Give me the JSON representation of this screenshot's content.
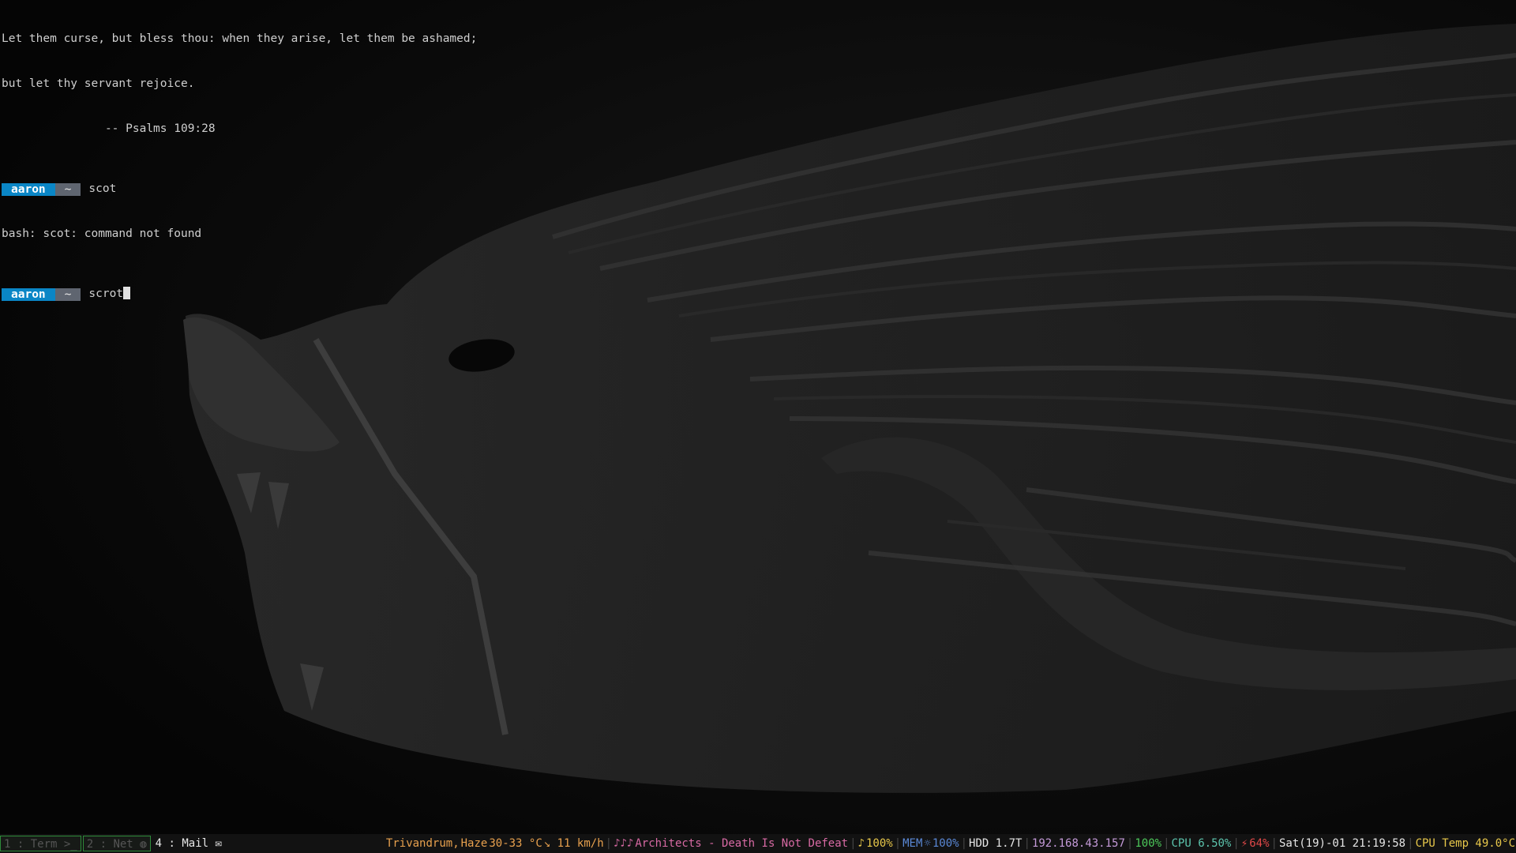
{
  "terminal": {
    "fortune": [
      "Let them curse, but bless thou: when they arise, let them be ashamed;",
      "but let thy servant rejoice.",
      "               -- Psalms 109:28"
    ],
    "prompt_user": "aaron",
    "prompt_dir": "~",
    "history": [
      {
        "command": "scot",
        "output": "bash: scot: command not found"
      }
    ],
    "current_input": "scrot"
  },
  "workspaces": [
    {
      "label": "1 : Term",
      "icon": "terminal-icon",
      "glyph": ">_",
      "active": false
    },
    {
      "label": "2 : Net",
      "icon": "globe-icon",
      "glyph": "◍",
      "active": false
    },
    {
      "label": "4 : Mail",
      "icon": "mail-icon",
      "glyph": "✉",
      "active": true
    }
  ],
  "status": {
    "weather_location": "Trivandrum,",
    "weather_condition": "Haze",
    "weather_temp": "30-33 °C",
    "weather_wind": "↘ 11 km/h",
    "music_icon": "♪♪♪",
    "music_track": "Architects - Death Is Not Defeat",
    "volume_icon": "♪",
    "volume": "100%",
    "mem_label": "MEM",
    "brightness_icon": "☼",
    "brightness": "100%",
    "hdd": "HDD 1.7T",
    "ip": "192.168.43.157",
    "wifi": "100%",
    "cpu": "CPU 6.50%",
    "battery_icon": "⚡",
    "battery": "64%",
    "datetime": "Sat(19)-01 21:19:58",
    "cpu_temp": "CPU Temp 49.0°C"
  },
  "colors": {
    "prompt_user_bg": "#0a86c6",
    "prompt_dir_bg": "#5f6570",
    "workspace_border": "#2e8b3a",
    "bar_bg": "#121212"
  }
}
